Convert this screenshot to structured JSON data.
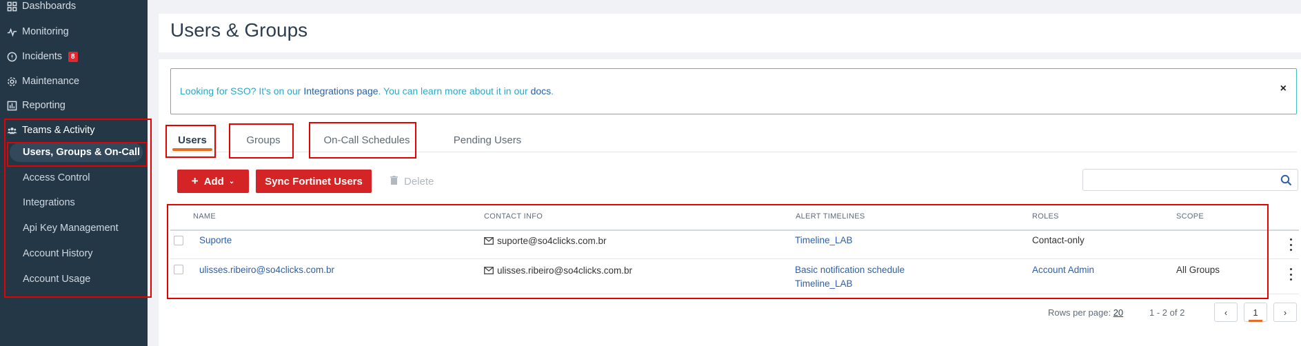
{
  "sidebar": {
    "items": [
      {
        "label": "Dashboards",
        "icon": "dashboard-icon"
      },
      {
        "label": "Monitoring",
        "icon": "activity-icon"
      },
      {
        "label": "Incidents",
        "icon": "info-circle-icon",
        "badge": "8"
      },
      {
        "label": "Maintenance",
        "icon": "gear-icon"
      },
      {
        "label": "Reporting",
        "icon": "bar-chart-icon"
      },
      {
        "label": "Teams & Activity",
        "icon": "users-icon"
      }
    ],
    "sub_items": [
      {
        "label": "Users, Groups & On-Call",
        "active": true
      },
      {
        "label": "Access Control"
      },
      {
        "label": "Integrations"
      },
      {
        "label": "Api Key Management"
      },
      {
        "label": "Account History"
      },
      {
        "label": "Account Usage"
      }
    ]
  },
  "header": {
    "title": "Users & Groups"
  },
  "alert": {
    "text_before": "Looking for SSO? It's on our ",
    "link1": "Integrations page",
    "text_middle": ". You can learn more about it in our ",
    "link2": "docs",
    "text_after": ".",
    "close": "×"
  },
  "tabs": [
    {
      "label": "Users",
      "active": true
    },
    {
      "label": "Groups"
    },
    {
      "label": "On-Call Schedules"
    },
    {
      "label": "Pending Users"
    }
  ],
  "toolbar": {
    "add_label": "Add",
    "sync_label": "Sync Fortinet Users",
    "delete_label": "Delete",
    "search_placeholder": ""
  },
  "table": {
    "columns": [
      "NAME",
      "CONTACT INFO",
      "ALERT TIMELINES",
      "ROLES",
      "SCOPE"
    ],
    "rows": [
      {
        "name": "Suporte",
        "contact": "suporte@so4clicks.com.br",
        "timelines": [
          "Timeline_LAB"
        ],
        "role": "Contact-only",
        "role_link": false,
        "scope": ""
      },
      {
        "name": "ulisses.ribeiro@so4clicks.com.br",
        "contact": "ulisses.ribeiro@so4clicks.com.br",
        "timelines": [
          "Basic notification schedule",
          "Timeline_LAB"
        ],
        "role": "Account Admin",
        "role_link": true,
        "scope": "All Groups"
      }
    ]
  },
  "pagination": {
    "rows_per_page_label": "Rows per page:",
    "rows_per_page": "20",
    "range": "1 - 2 of 2",
    "prev": "‹",
    "current_page": "1",
    "next": "›"
  },
  "colors": {
    "sidebar_bg": "#243746",
    "primary_button": "#d42426",
    "link": "#2d5fa8",
    "accent_underline": "#e36e24",
    "alert_border": "#3fbfbf",
    "annotation_red": "#e60000"
  }
}
